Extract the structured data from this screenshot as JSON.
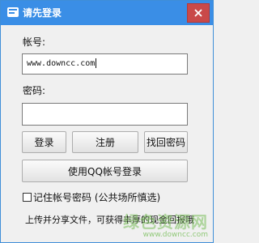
{
  "window": {
    "title": "请先登录",
    "accent_color": "#3a8ee6",
    "close_icon": "close-icon"
  },
  "form": {
    "account_label": "帐号:",
    "account_value": "www.downcc.com",
    "password_label": "密码:",
    "password_value": ""
  },
  "buttons": {
    "login": "登录",
    "register": "注册",
    "recover": "找回密码",
    "qq_login": "使用QQ帐号登录"
  },
  "remember": {
    "label": "记住帐号密码 (公共场所慎选)",
    "checked": false
  },
  "footer": {
    "text": "上传并分享文件，可获得丰厚的现金回报哦"
  },
  "watermark": {
    "text": "绿色资源网",
    "url": "www.downcc.com"
  }
}
